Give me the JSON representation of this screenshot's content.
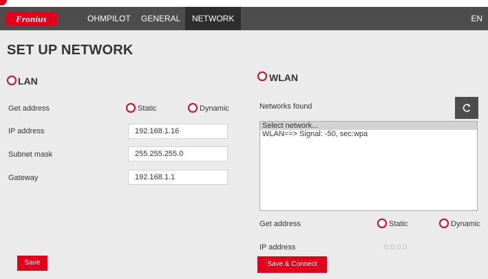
{
  "header": {
    "logo": "Fronius",
    "nav": [
      {
        "label": "OHMPILOT"
      },
      {
        "label": "GENERAL"
      },
      {
        "label": "NETWORK"
      }
    ],
    "language": "EN"
  },
  "page": {
    "title": "SET UP NETWORK"
  },
  "lan": {
    "heading": "LAN",
    "get_address_label": "Get address",
    "static_label": "Static",
    "dynamic_label": "Dynamic",
    "ip_label": "IP address",
    "ip_value": "192.168.1.16",
    "subnet_label": "Subnet mask",
    "subnet_value": "255.255.255.0",
    "gateway_label": "Gateway",
    "gateway_value": "192.168.1.1",
    "save_label": "Save"
  },
  "wlan": {
    "heading": "WLAN",
    "networks_found_label": "Networks found",
    "refresh_icon": "refresh-icon",
    "networks": [
      {
        "label": "Select network..."
      },
      {
        "label": "WLAN==> Signal: -50, sec:wpa"
      }
    ],
    "get_address_label": "Get address",
    "static_label": "Static",
    "dynamic_label": "Dynamic",
    "ip_label": "IP address",
    "ip_value": "0.0.0.0",
    "save_connect_label": "Save & Connect"
  },
  "colors": {
    "brand_red": "#e2001a",
    "navbar": "#4d4d4d",
    "background": "#ebebeb"
  }
}
